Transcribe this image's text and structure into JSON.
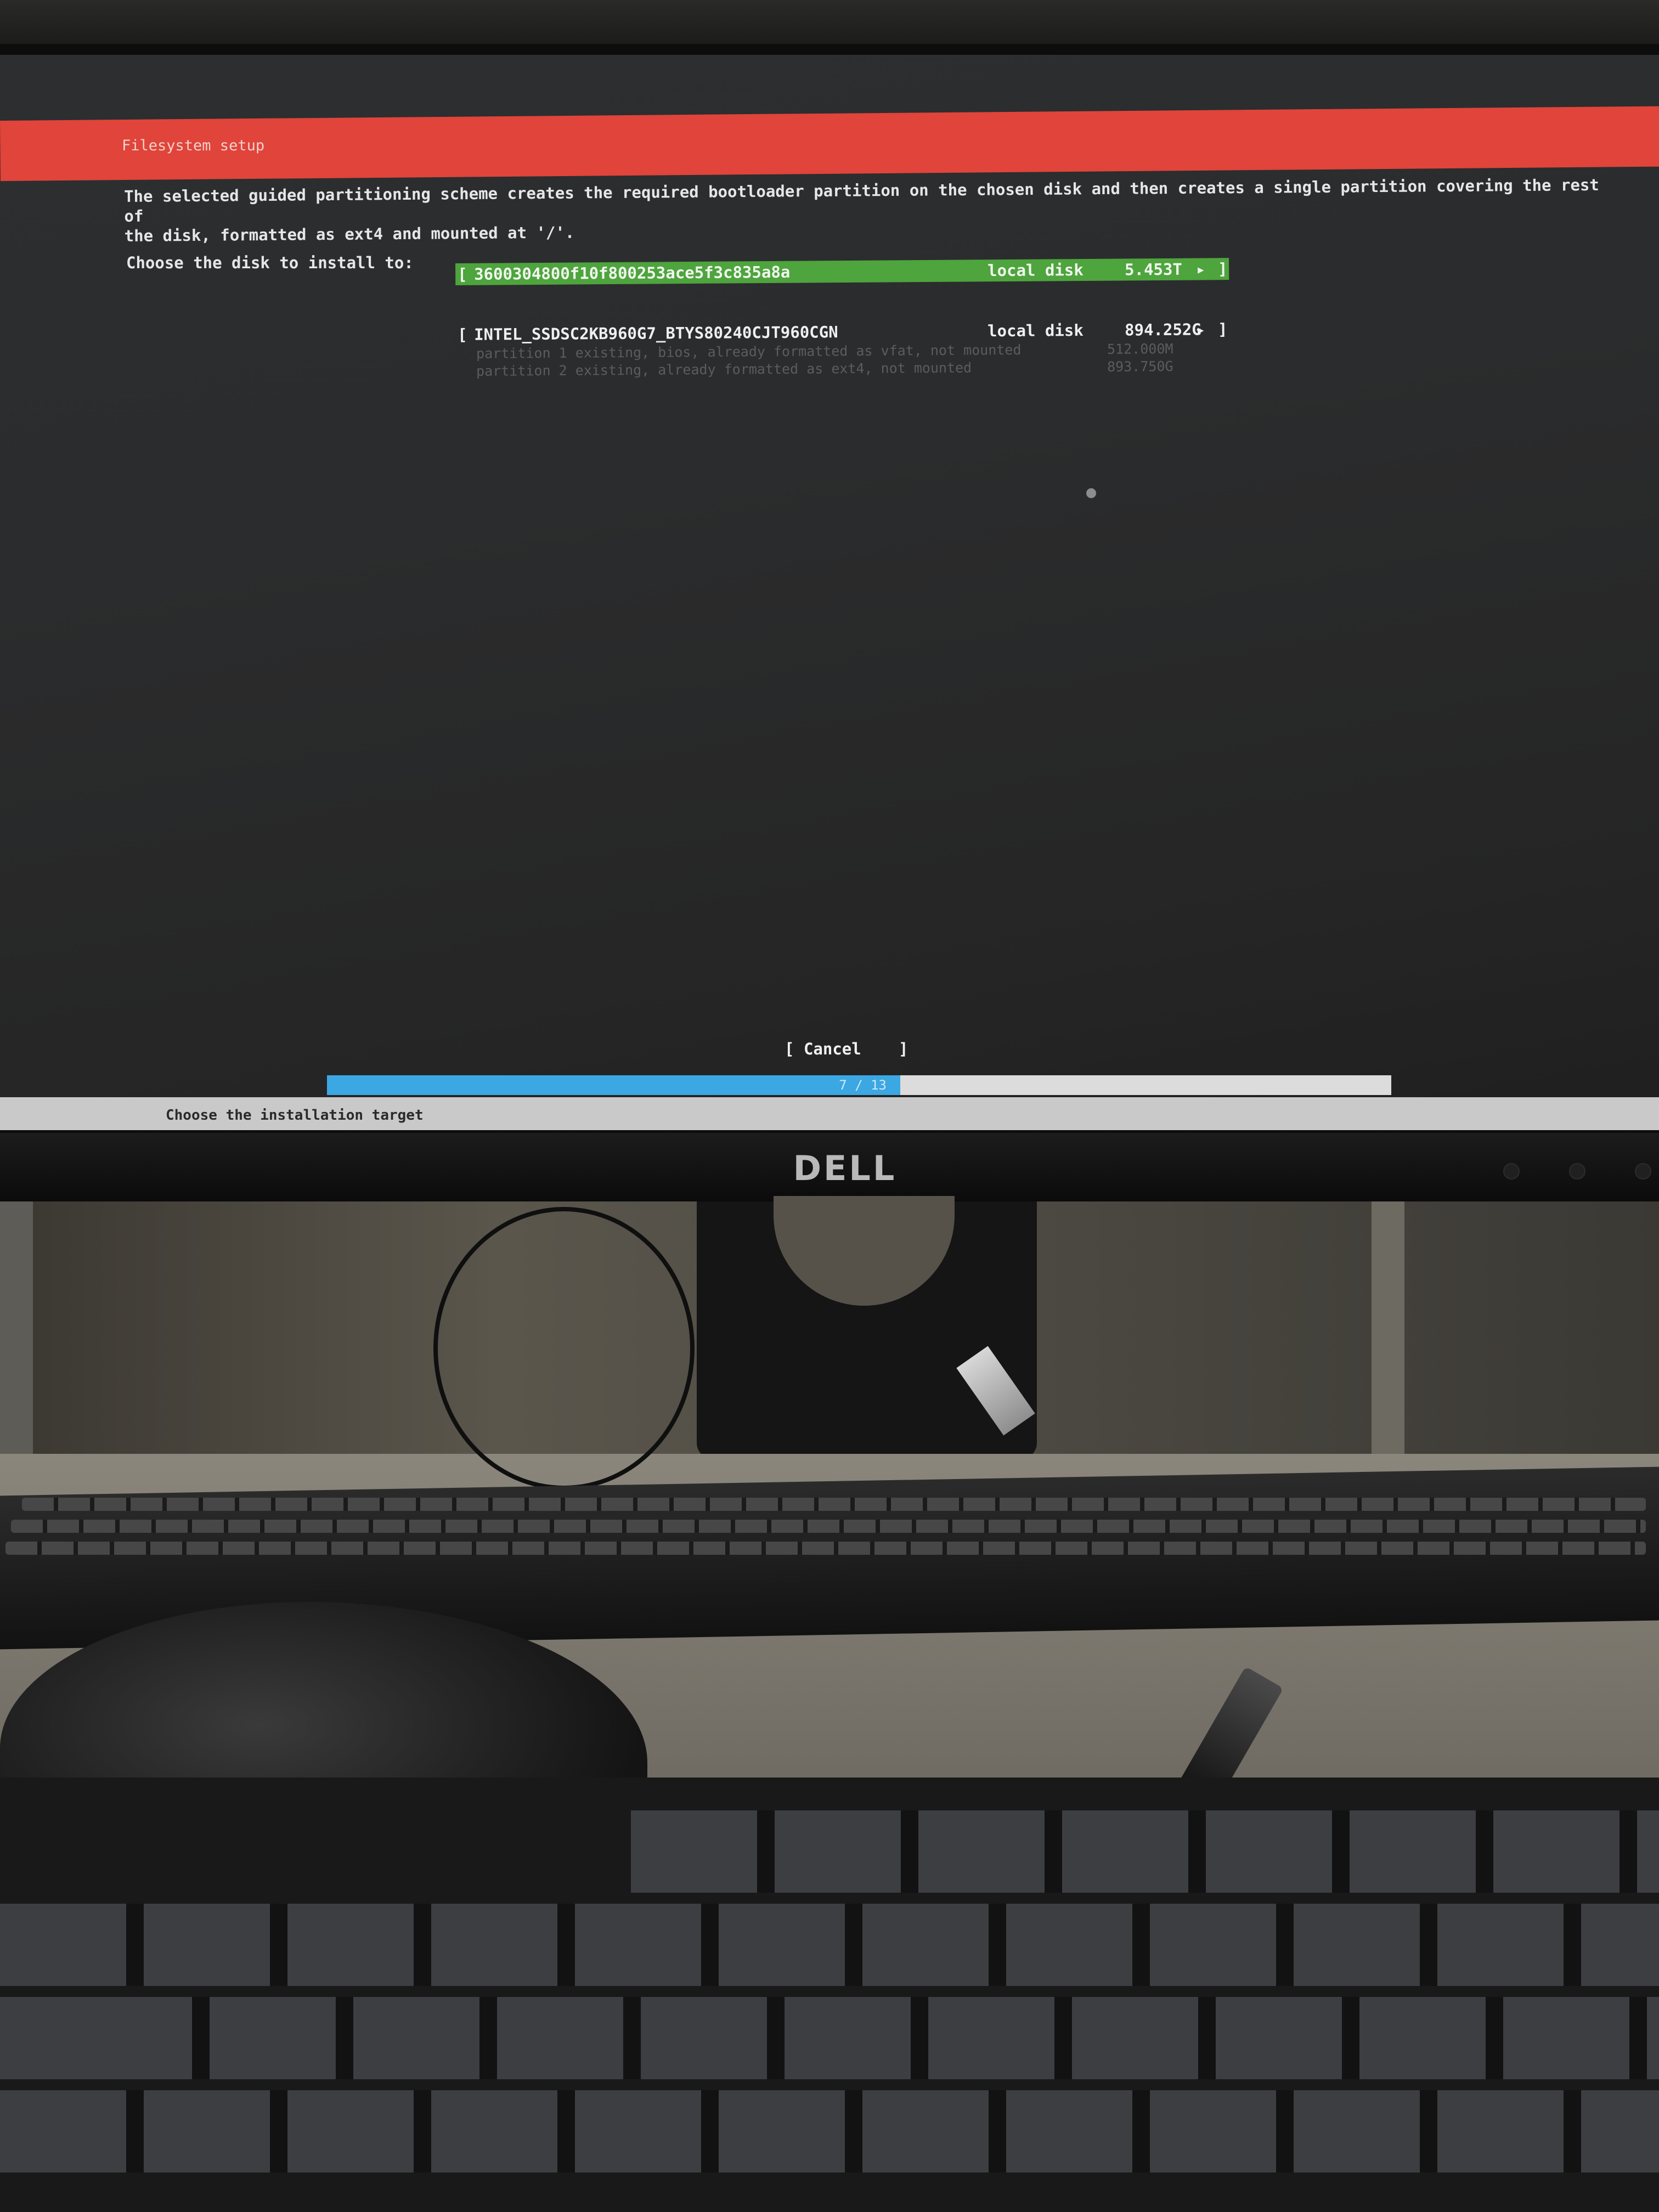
{
  "installer": {
    "title": "Filesystem setup",
    "description": "The selected guided partitioning scheme creates the required bootloader partition on the chosen disk and then creates a single partition covering the rest of\nthe disk, formatted as ext4 and mounted at '/'.",
    "choose_label": "Choose the disk to install to:",
    "disks": [
      {
        "bracket_open": "[",
        "name": "3600304800f10f800253ace5f3c835a8a",
        "type": "local disk",
        "size": "5.453T",
        "arrow": "▸",
        "bracket_close": "]",
        "selected": true
      },
      {
        "bracket_open": "[",
        "name": "INTEL_SSDSC2KB960G7_BTYS80240CJT960CGN",
        "type": "local disk",
        "size": "894.252G",
        "arrow": "▸",
        "bracket_close": "]",
        "selected": false,
        "partitions": [
          {
            "desc": "partition 1 existing, bios, already formatted as vfat, not mounted",
            "size": "512.000M"
          },
          {
            "desc": "partition 2 existing, already formatted as ext4, not mounted",
            "size": "893.750G"
          }
        ]
      }
    ],
    "cancel": {
      "open": "[",
      "label": "Cancel",
      "close": "]"
    },
    "progress": {
      "label": "7 / 13",
      "current": 7,
      "total": 13
    },
    "footer": "Choose the installation target"
  },
  "colors": {
    "title_bar": "#e0443a",
    "selected_row": "#4ea43d",
    "progress_fill": "#3ba7e3",
    "screen_bg": "#2b2c2d"
  },
  "monitor": {
    "brand": "DELL"
  }
}
